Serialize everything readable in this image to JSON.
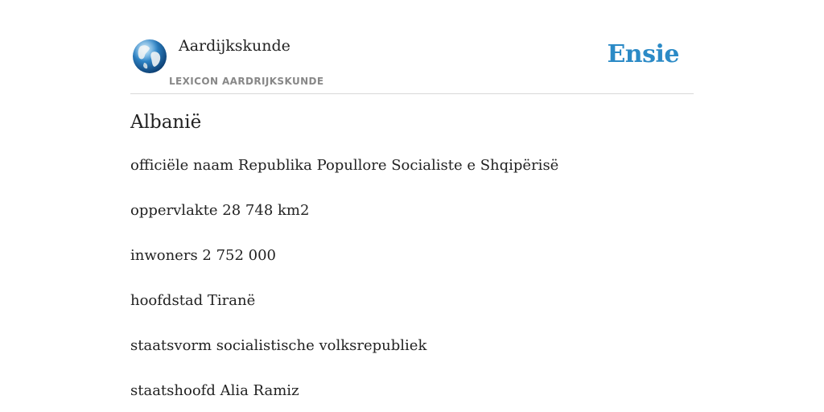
{
  "header": {
    "site_title": "Aardijkskunde",
    "site_subtitle": "LEXICON AARDRIJKSKUNDE",
    "brand": "Ensie",
    "logo_icon": "globe-icon",
    "brand_color": "#2b8ac6"
  },
  "entry": {
    "title": "Albanië",
    "facts": [
      "officiële naam Republika Popullore Socialiste e Shqipërisë",
      "oppervlakte 28 748 km2",
      "inwoners 2 752 000",
      "hoofdstad Tiranë",
      "staatsvorm socialistische volksrepubliek",
      "staatshoofd Alia Ramiz"
    ]
  }
}
